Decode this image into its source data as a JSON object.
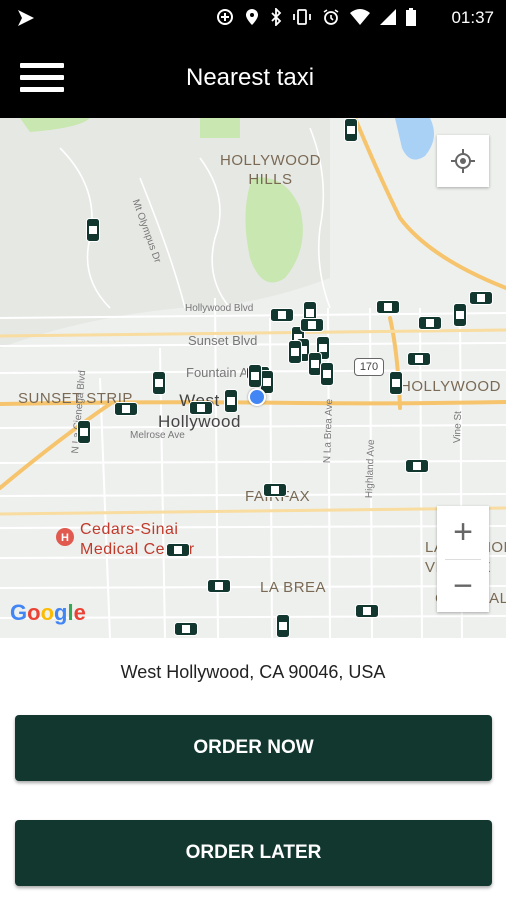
{
  "status_bar": {
    "time": "01:37",
    "icons": [
      "app-notification-icon",
      "data-saver-icon",
      "location-icon",
      "bluetooth-icon",
      "vibrate-icon",
      "alarm-icon",
      "wifi-icon",
      "signal-icon",
      "battery-icon"
    ]
  },
  "app_bar": {
    "title": "Nearest taxi",
    "menu_icon": "hamburger-menu-icon"
  },
  "map": {
    "labels": {
      "hollywood_hills": "HOLLYWOOD\nHILLS",
      "sunset_strip": "SUNSET STRIP",
      "west_hollywood": "West\nHollywood",
      "hollywood": "HOLLYWOOD",
      "fairfax": "FAIRFAX",
      "la_brea": "LA BREA",
      "cedars_sinai": "Cedars-Sinai\nMedical Center",
      "larchmont_village": "LARCHMONT\nVILLAGE",
      "central": "CENTRAL",
      "hollywood_blvd": "Hollywood Blvd",
      "sunset_blvd": "Sunset Blvd",
      "fountain_ave": "Fountain Av",
      "melrose_ave": "Melrose Ave",
      "la_cienega": "N La Cienega Blvd",
      "la_brea_ave": "N La Brea Ave",
      "highland": "Highland Ave",
      "vine": "Vine St",
      "mt_olympus": "Mt Olympus Dr",
      "route_170": "170",
      "google": "Google"
    },
    "controls": {
      "locate_icon": "my-location-icon",
      "zoom_in": "+",
      "zoom_out": "−"
    },
    "taxi_count": 32
  },
  "address": "West Hollywood, CA 90046, USA",
  "buttons": {
    "order_now": "ORDER NOW",
    "order_later": "ORDER LATER"
  },
  "colors": {
    "brand": "#12372f",
    "map_bg": "#eef0ee",
    "park": "#c9e7b0",
    "water": "#a9d0f5",
    "highway": "#f6c46c",
    "user_location": "#4285f4"
  }
}
